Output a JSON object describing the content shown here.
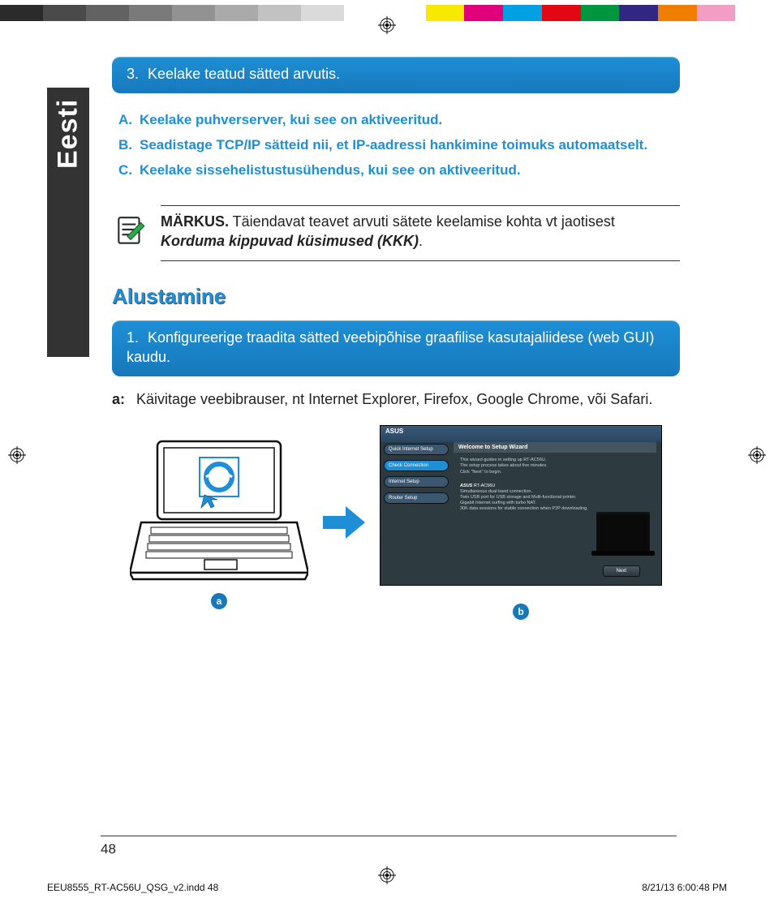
{
  "colorbar_left": [
    "#2b2b2b",
    "#4a4a4a",
    "#626262",
    "#7a7a7a",
    "#929292",
    "#aaaaaa",
    "#c2c2c2",
    "#dadada",
    "#ffffff"
  ],
  "colorbar_right": [
    "#ffffff",
    "#f7ea00",
    "#e2007a",
    "#00a0e3",
    "#e30613",
    "#009640",
    "#312783",
    "#ef7d00",
    "#f29ec4",
    "#ffffff"
  ],
  "side_tab": "Eesti",
  "bar3_num": "3.",
  "bar3_text": "Keelake teatud sätted arvutis.",
  "sub": {
    "a_label": "A.",
    "a_text": "Keelake puhverserver, kui see on aktiveeritud.",
    "b_label": "B.",
    "b_text": "Seadistage TCP/IP sätteid nii, et IP-aadressi hankimine toimuks automaatselt.",
    "c_label": "C.",
    "c_text": "Keelake sissehelistustusühendus, kui see on aktiveeritud."
  },
  "note_bold": "MÄRKUS.",
  "note_text1": "  Täiendavat teavet arvuti sätete keelamise kohta vt jaotisest ",
  "note_italic": "Korduma kippuvad küsimused (KKK)",
  "note_period": ".",
  "section_heading": "Alustamine",
  "bar1_num": "1.",
  "bar1_text": "Konfigureerige traadita sätted veebipõhise graafilise kasutajaliidese (web GUI) kaudu.",
  "step_a_label": "a:",
  "step_a_text": "Käivitage veebibrauser, nt Internet Explorer, Firefox, Google Chrome, või Safari.",
  "fig_a": "a",
  "fig_b": "b",
  "wizard": {
    "brand": "ASUS",
    "side1": "Quick Internet Setup",
    "side2": "Check Connection",
    "side3": "Internet Setup",
    "side4": "Router Setup",
    "title": "Welcome to Setup Wizard",
    "line1": "This wizard guides in setting up RT-AC56U.",
    "line2": "The setup process takes about five minutes.",
    "line3": "Click \"Next\" to begin.",
    "model_brand": "ASUS",
    "model": " RT-AC56U",
    "feat1": "Simultaneous dual-band connection.",
    "feat2": "Twin USB port for USB storage and Multi-functional printer.",
    "feat3": "Gigabit Internet surfing with turbo NAT.",
    "feat4": "30K data sessions for stable connection when P2P downloading.",
    "next": "Next"
  },
  "page_number": "48",
  "footer_left": "EEU8555_RT-AC56U_QSG_v2.indd   48",
  "footer_right": "8/21/13   6:00:48 PM"
}
